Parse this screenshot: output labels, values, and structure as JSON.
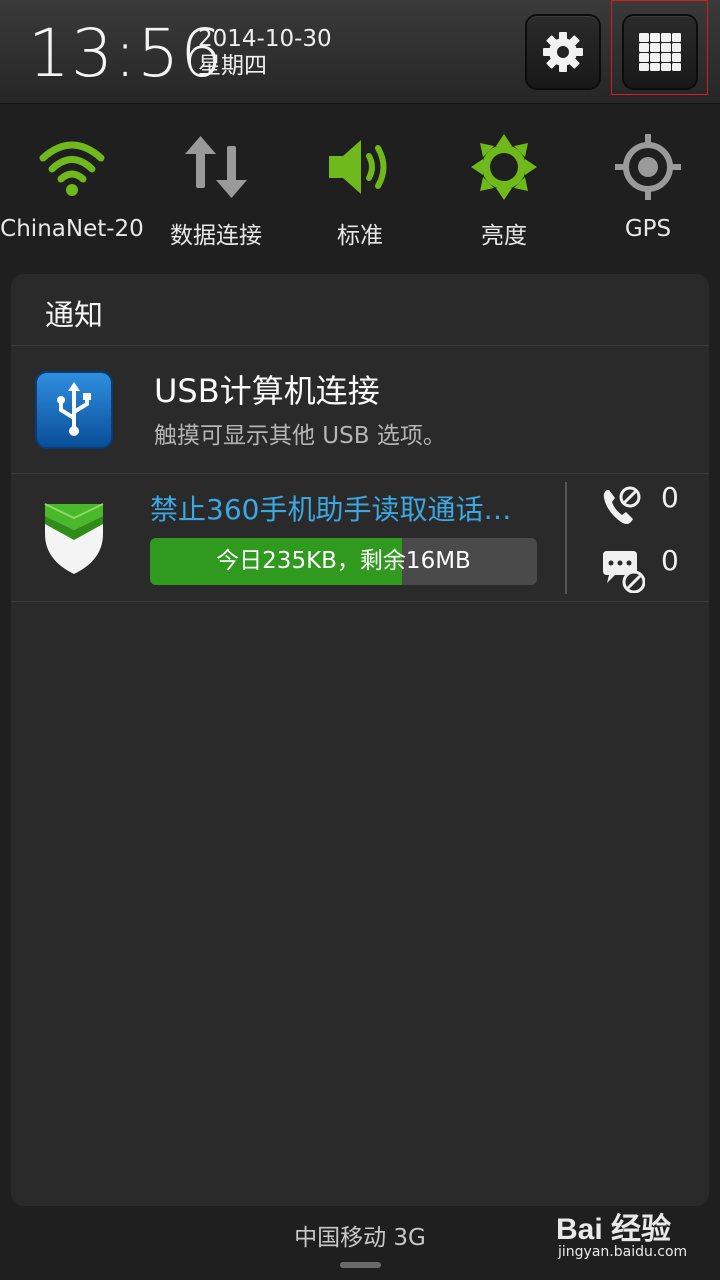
{
  "status": {
    "time": "13:56",
    "date": "2014-10-30",
    "weekday": "星期四"
  },
  "toggles": [
    {
      "label": "ChinaNet-20",
      "icon": "wifi-icon",
      "color": "#6fb91d"
    },
    {
      "label": "数据连接",
      "icon": "data-sync-icon",
      "color": "#9a9a9a"
    },
    {
      "label": "标准",
      "icon": "volume-icon",
      "color": "#6fb91d"
    },
    {
      "label": "亮度",
      "icon": "brightness-icon",
      "color": "#6fb91d"
    },
    {
      "label": "GPS",
      "icon": "gps-icon",
      "color": "#9a9a9a"
    }
  ],
  "notifications": {
    "title": "通知",
    "usb": {
      "title": "USB计算机连接",
      "subtitle": "触摸可显示其他 USB 选项。"
    },
    "security": {
      "title": "禁止360手机助手读取通话…",
      "usage_text": "今日235KB，剩余16MB",
      "usage_fraction": 0.65,
      "blocked_calls": "0",
      "blocked_messages": "0"
    }
  },
  "footer": {
    "carrier": "中国移动 3G"
  },
  "watermark": {
    "logo": "Bai 经验",
    "url": "jingyan.baidu.com"
  },
  "colors": {
    "accent_green": "#6fb91d",
    "link_blue": "#3ca7e3",
    "progress_green": "#2f9a1d",
    "highlight_red": "#d21e1e"
  }
}
